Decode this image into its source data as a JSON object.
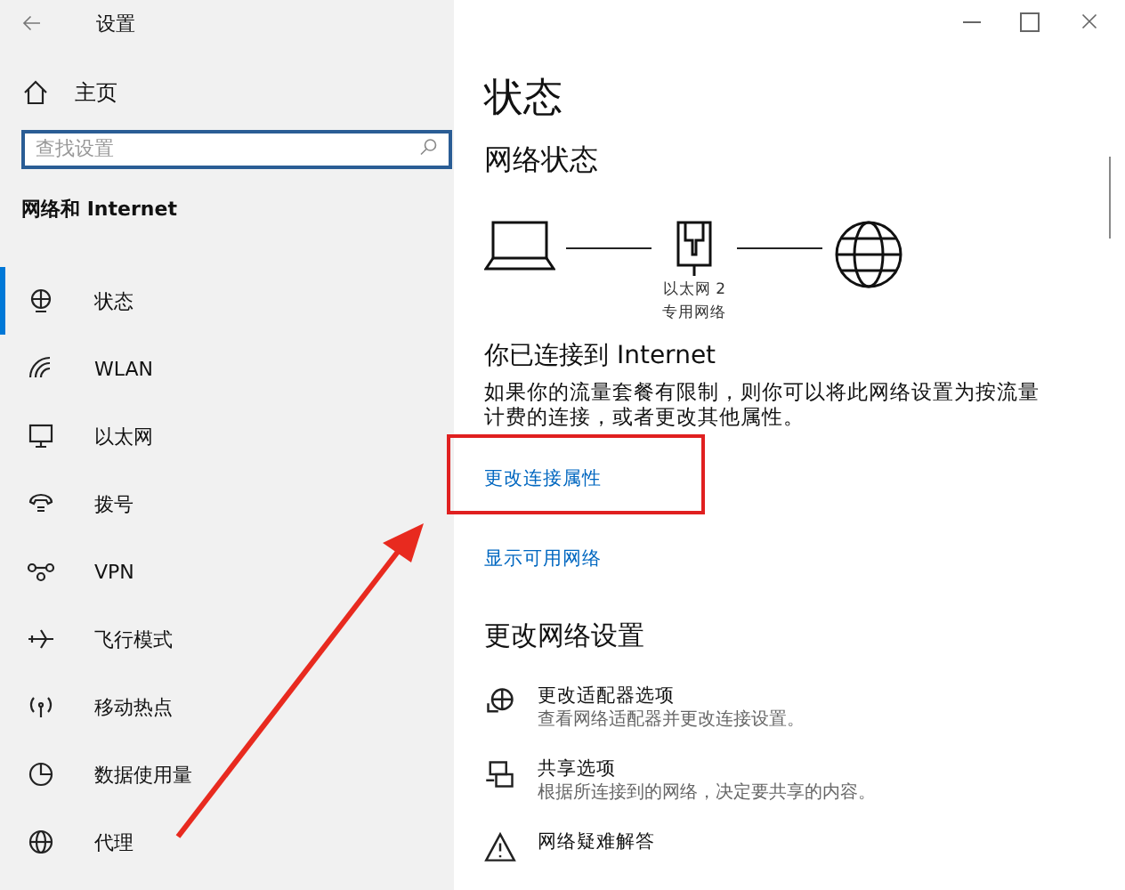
{
  "window": {
    "title": "设置"
  },
  "sidebar": {
    "home": "主页",
    "search": {
      "placeholder": "查找设置"
    },
    "section": "网络和 Internet",
    "items": [
      {
        "label": "状态",
        "selected": true
      },
      {
        "label": "WLAN",
        "selected": false
      },
      {
        "label": "以太网",
        "selected": false
      },
      {
        "label": "拨号",
        "selected": false
      },
      {
        "label": "VPN",
        "selected": false
      },
      {
        "label": "飞行模式",
        "selected": false
      },
      {
        "label": "移动热点",
        "selected": false
      },
      {
        "label": "数据使用量",
        "selected": false
      },
      {
        "label": "代理",
        "selected": false
      }
    ]
  },
  "content": {
    "title": "状态",
    "network_status": {
      "heading": "网络状态",
      "adapter_name": "以太网 2",
      "network_type": "专用网络"
    },
    "connected": {
      "heading": "你已连接到 Internet",
      "text": "如果你的流量套餐有限制，则你可以将此网络设置为按流量计费的连接，或者更改其他属性。"
    },
    "links": [
      {
        "label": "更改连接属性",
        "highlighted": true
      },
      {
        "label": "显示可用网络",
        "highlighted": false
      }
    ],
    "settings_heading": "更改网络设置",
    "settings": [
      {
        "title": "更改适配器选项",
        "description": "查看网络适配器并更改连接设置。"
      },
      {
        "title": "共享选项",
        "description": "根据所连接到的网络，决定要共享的内容。"
      },
      {
        "title": "网络疑难解答"
      }
    ]
  }
}
